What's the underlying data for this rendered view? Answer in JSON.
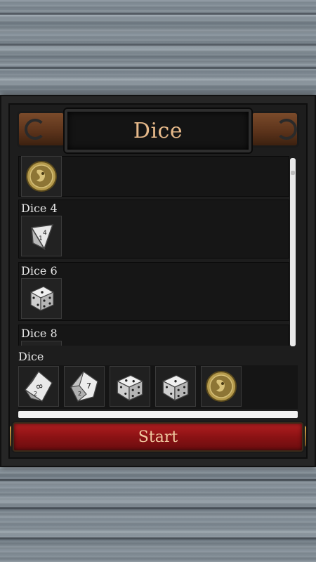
{
  "header": {
    "title": "Dice"
  },
  "dice_list": {
    "items": [
      {
        "label": "",
        "icon": "coin-icon"
      },
      {
        "label": "Dice 4",
        "icon": "d4-die-icon"
      },
      {
        "label": "Dice 6",
        "icon": "d6-die-icon"
      },
      {
        "label": "Dice 8",
        "icon": "d8-die-icon"
      }
    ]
  },
  "tray": {
    "label": "Dice",
    "slots": [
      {
        "icon": "d8-die-icon"
      },
      {
        "icon": "d10-die-icon"
      },
      {
        "icon": "d6-die-icon"
      },
      {
        "icon": "d6-die-icon"
      },
      {
        "icon": "coin-icon"
      }
    ]
  },
  "start_button": {
    "label": "Start"
  },
  "colors": {
    "title_text": "#e6b98a",
    "start_button": "#9a1618",
    "panel": "#1d1d1d"
  }
}
